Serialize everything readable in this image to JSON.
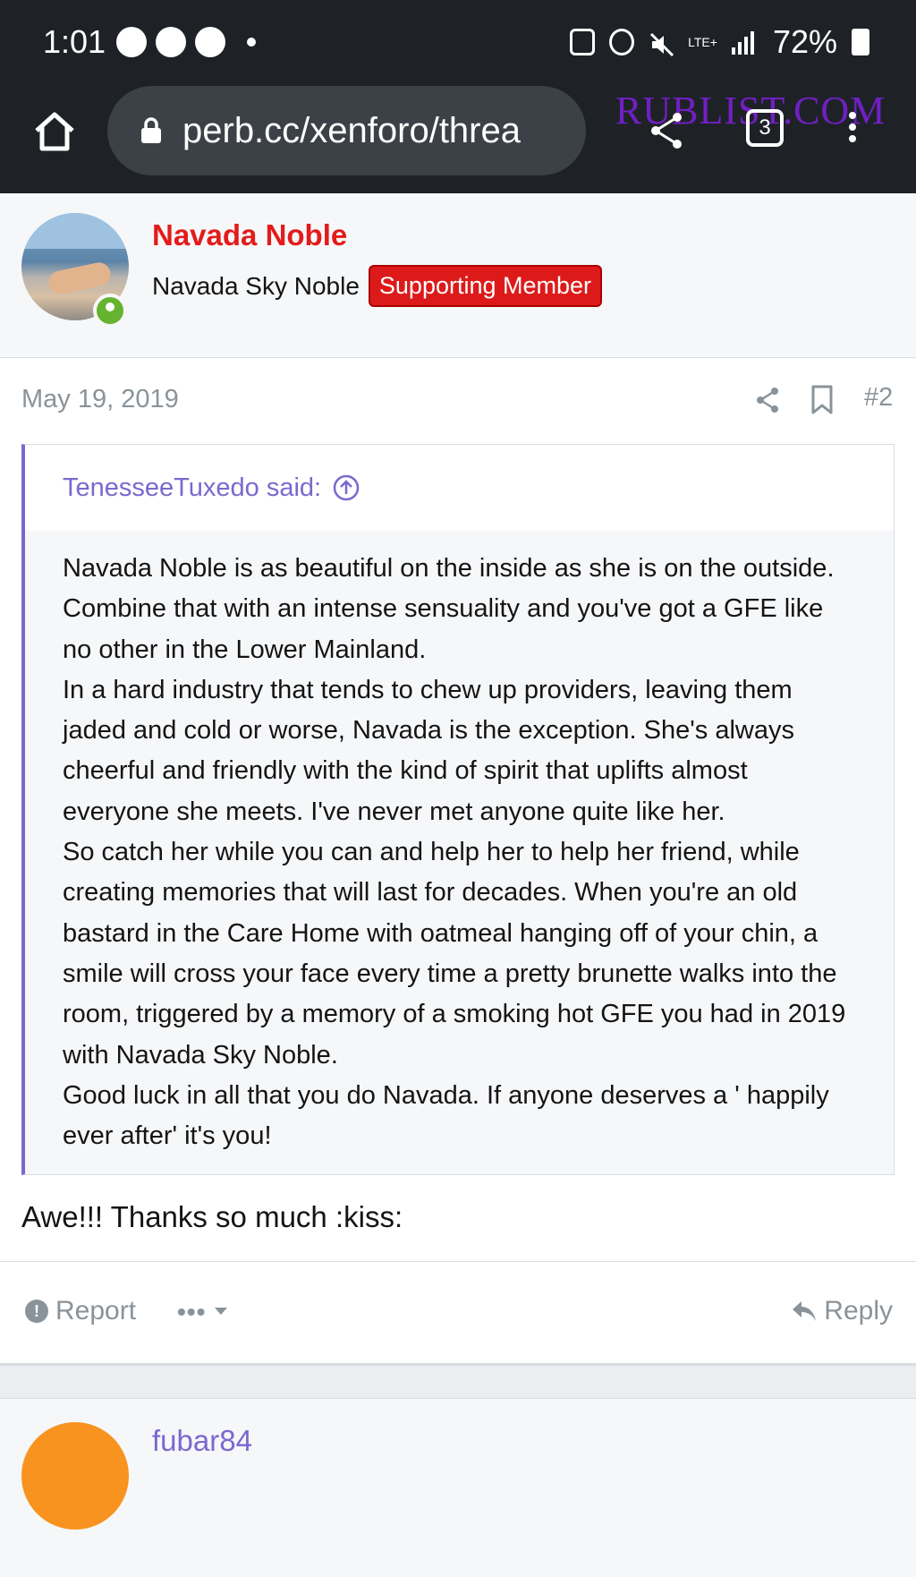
{
  "status_bar": {
    "time": "1:01",
    "network": "LTE+",
    "battery": "72%"
  },
  "browser": {
    "url": "perb.cc/xenforo/threa",
    "tab_count": "3",
    "watermark": "RUBLIST.COM"
  },
  "author": {
    "name": "Navada Noble",
    "title": "Navada Sky Noble",
    "badge": "Supporting Member"
  },
  "post": {
    "date": "May 19, 2019",
    "number": "#2",
    "quote_author": "TenesseeTuxedo said:",
    "quote_paragraphs": [
      "Navada Noble is as beautiful on the inside as she is on the outside. Combine that with an intense sensuality and you've got a GFE like no other in the Lower Mainland.",
      "In a hard industry that tends to chew up providers, leaving them jaded and cold or worse, Navada is the exception. She's always cheerful and friendly with the kind of spirit that uplifts almost everyone she meets. I've never met anyone quite like her.",
      "So catch her while you can and help her to help her friend, while creating memories that will last for decades. When you're an old bastard in the Care Home with oatmeal hanging off of your chin, a smile will cross your face every time a pretty brunette walks into the room, triggered by a memory of a smoking hot GFE you had in 2019 with Navada Sky Noble.",
      "Good luck in all that you do Navada. If anyone deserves a ' happily ever after' it's you!"
    ],
    "reply_text": "Awe!!! Thanks so much :kiss:"
  },
  "actions": {
    "report": "Report",
    "more": "•••",
    "reply": "Reply"
  },
  "next_post": {
    "author": "fubar84"
  }
}
